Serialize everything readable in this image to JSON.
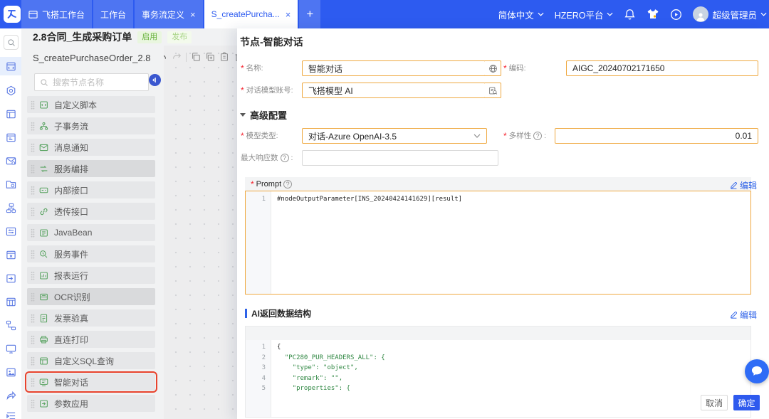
{
  "topbar": {
    "tabs": [
      {
        "label": "飞搭工作台"
      },
      {
        "label": "工作台"
      },
      {
        "label": "事务流定义",
        "close": "×"
      },
      {
        "label": "S_createPurcha...",
        "close": "×"
      }
    ],
    "plus": "+",
    "language": "简体中文",
    "tenant": "HZERO平台",
    "user": "超级管理员"
  },
  "flow": {
    "title": "2.8合同_生成采购订单",
    "badges": [
      "启用",
      "发布"
    ],
    "flow_code": "S_createPurchaseOrder_2.8",
    "search_placeholder": "搜索节点名称",
    "palette": [
      "自定义脚本",
      "子事务流",
      "消息通知",
      "服务编排",
      "内部接口",
      "透传接口",
      "JavaBean",
      "服务事件",
      "报表运行",
      "OCR识别",
      "发票验真",
      "直连打印",
      "自定义SQL查询",
      "智能对话",
      "参数应用"
    ]
  },
  "panel": {
    "title": "节点-智能对话",
    "required_marker": "*",
    "colon": ":",
    "help_mark": "?",
    "fields": {
      "name_label": "名称",
      "name_value": "智能对话",
      "code_label": "编码",
      "code_value": "AIGC_20240702171650",
      "account_label": "对话模型账号",
      "account_value": "飞搭模型 AI",
      "section": "高级配置",
      "model_label": "模型类型",
      "model_value": "对话-Azure OpenAI-3.5",
      "diversity_label": "多样性",
      "diversity_value": "0.01",
      "max_resp_label": "最大响应数"
    },
    "prompt": {
      "label": "Prompt",
      "edit": "编辑",
      "line_no": "1",
      "code": "#nodeOutputParameter[INS_20240424141629][result]"
    },
    "ai_schema": {
      "title": "AI返回数据结构",
      "edit": "编辑",
      "line_nos": [
        "1",
        "2",
        "3",
        "4",
        "5"
      ],
      "lines": [
        "{",
        "  \"PC280_PUR_HEADERS_ALL\": {",
        "    \"type\": \"object\",",
        "    \"remark\": \"\",",
        "    \"properties\": {"
      ]
    },
    "footer": {
      "cancel": "取消",
      "ok": "确定"
    }
  }
}
